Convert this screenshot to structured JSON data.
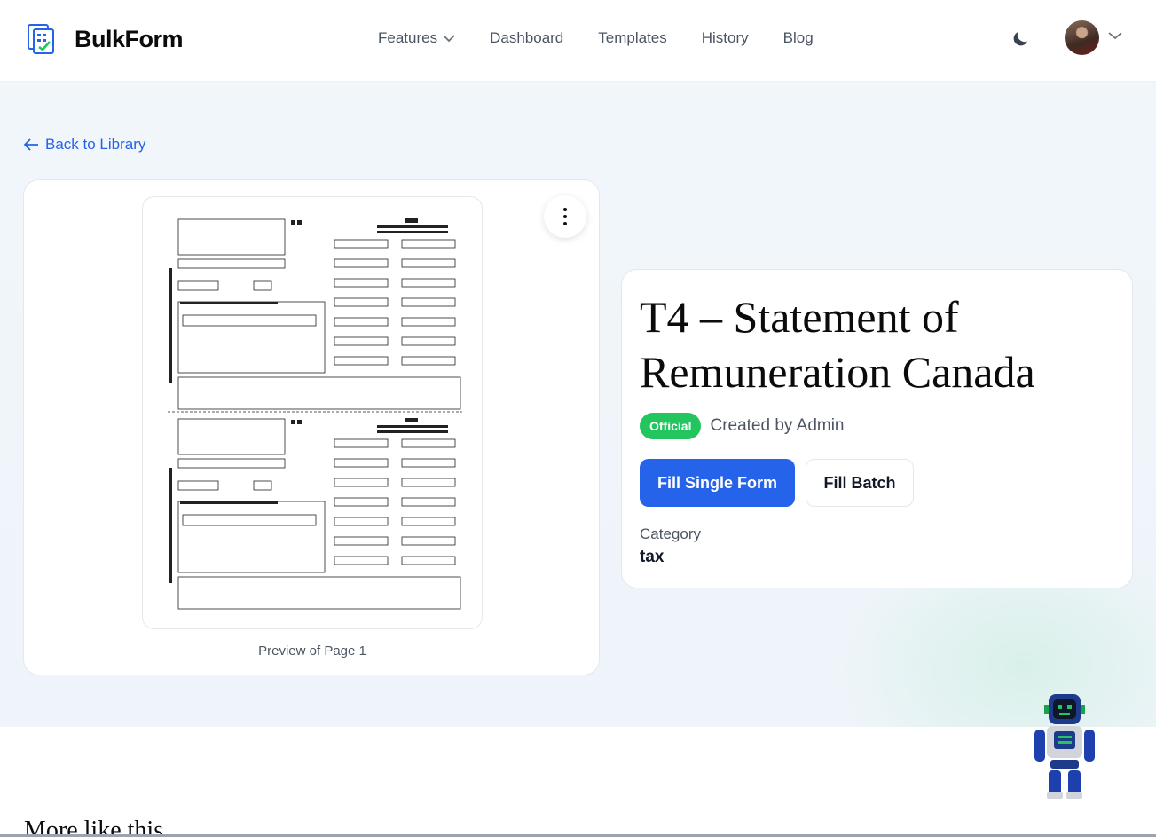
{
  "brand": {
    "name": "BulkForm"
  },
  "nav": [
    {
      "label": "Features",
      "has_dropdown": true
    },
    {
      "label": "Dashboard"
    },
    {
      "label": "Templates"
    },
    {
      "label": "History"
    },
    {
      "label": "Blog"
    }
  ],
  "header": {
    "theme_icon": "moon-icon",
    "avatar_icon": "user-avatar"
  },
  "back_link": {
    "label": "Back to Library"
  },
  "preview": {
    "caption": "Preview of Page 1"
  },
  "form": {
    "title": "T4 – Statement of Remuneration Canada",
    "badge": "Official",
    "created_by": "Created by Admin",
    "fill_single_label": "Fill Single Form",
    "fill_batch_label": "Fill Batch",
    "category_label": "Category",
    "category_value": "tax"
  },
  "section": {
    "more_like_this": "More like this"
  },
  "colors": {
    "primary": "#2563eb",
    "badge_green": "#22c55e",
    "hero_bg": "#f1f6fb"
  }
}
